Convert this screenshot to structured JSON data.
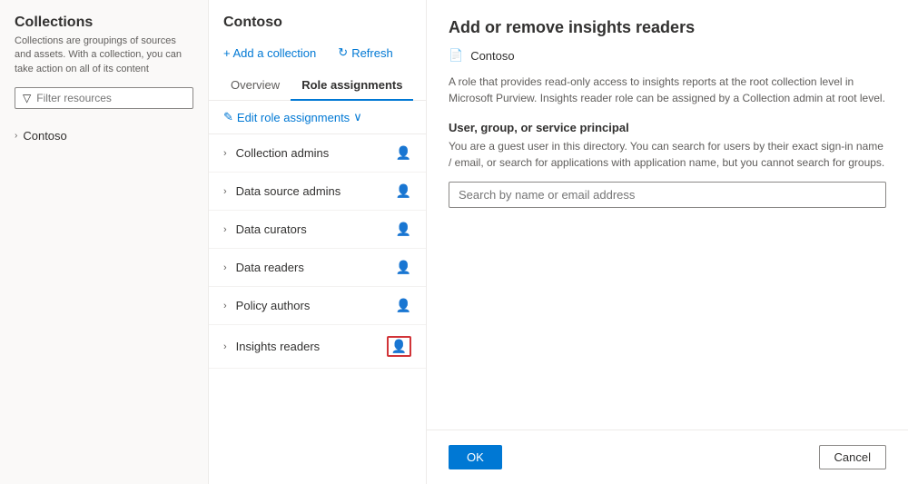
{
  "sidebar": {
    "title": "Collections",
    "description": "Collections are groupings of sources and assets. With a collection, you can take action on all of its content",
    "filter_placeholder": "Filter resources",
    "items": [
      {
        "label": "Contoso",
        "level": 0
      }
    ]
  },
  "middle": {
    "collection_name": "Contoso",
    "toolbar": {
      "add_label": "+ Add a collection",
      "refresh_label": "Refresh"
    },
    "tabs": [
      {
        "label": "Overview",
        "active": false
      },
      {
        "label": "Role assignments",
        "active": true
      }
    ],
    "edit_label": "Edit role assignments",
    "roles": [
      {
        "label": "Collection admins",
        "highlighted": false
      },
      {
        "label": "Data source admins",
        "highlighted": false
      },
      {
        "label": "Data curators",
        "highlighted": false
      },
      {
        "label": "Data readers",
        "highlighted": false
      },
      {
        "label": "Policy authors",
        "highlighted": false
      },
      {
        "label": "Insights readers",
        "highlighted": true
      }
    ]
  },
  "right": {
    "title": "Add or remove insights readers",
    "subtitle": "Contoso",
    "description": "A role that provides read-only access to insights reports at the root collection level in Microsoft Purview. Insights reader role can be assigned by a Collection admin at root level.",
    "section_label": "User, group, or service principal",
    "section_sublabel": "You are a guest user in this directory. You can search for users by their exact sign-in name / email, or search for applications with application name, but you cannot search for groups.",
    "search_placeholder": "Search by name or email address",
    "ok_label": "OK",
    "cancel_label": "Cancel"
  }
}
